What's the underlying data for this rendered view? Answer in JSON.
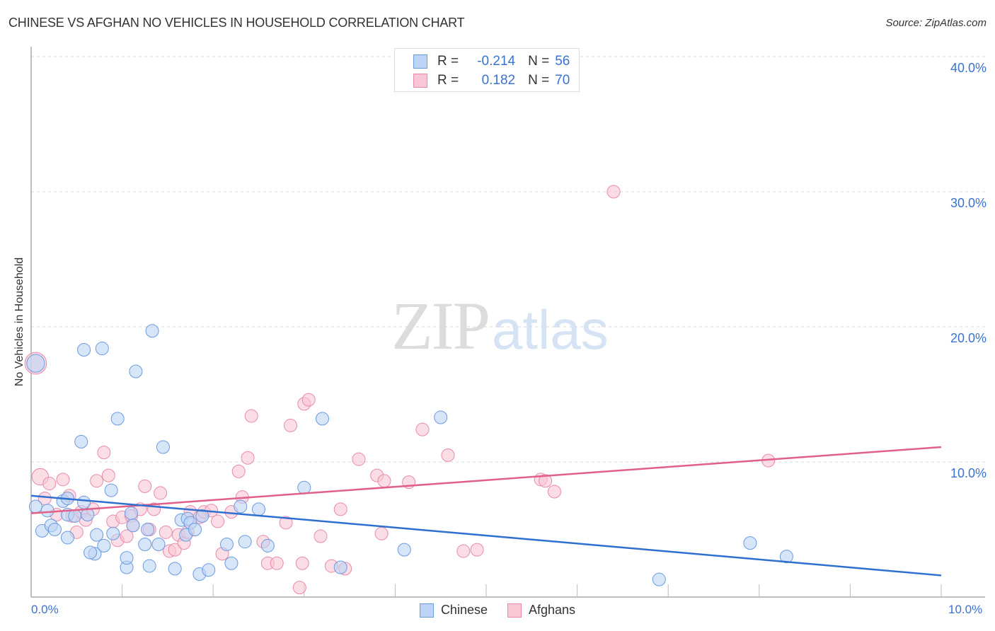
{
  "header": {
    "title": "CHINESE VS AFGHAN NO VEHICLES IN HOUSEHOLD CORRELATION CHART",
    "source": "Source: ZipAtlas.com"
  },
  "watermark": {
    "zip": "ZIP",
    "atlas": "atlas"
  },
  "legend_top": {
    "rows": [
      {
        "r_label": "R =",
        "r_value": "-0.214",
        "n_label": "N =",
        "n_value": "56",
        "series": "Chinese"
      },
      {
        "r_label": "R =",
        "r_value": "0.182",
        "n_label": "N =",
        "n_value": "70",
        "series": "Afghans"
      }
    ]
  },
  "colors": {
    "chinese_fill": "#bcd4f5",
    "chinese_stroke": "#6a9ae0",
    "chinese_line": "#2f6fcf",
    "afghans_fill": "#f9c6d6",
    "afghans_stroke": "#e88aa7",
    "afghans_line": "#e0608a",
    "tick_text": "#3a72d0"
  },
  "chart_data": {
    "type": "scatter",
    "title": "CHINESE VS AFGHAN NO VEHICLES IN HOUSEHOLD CORRELATION CHART",
    "xlabel": "",
    "ylabel": "No Vehicles in Household",
    "xlim": [
      0,
      10
    ],
    "ylim": [
      0,
      40
    ],
    "x_unit": "%",
    "y_unit": "%",
    "x_ticks": [
      "0.0%",
      "10.0%"
    ],
    "y_ticks": [
      "10.0%",
      "20.0%",
      "30.0%",
      "40.0%"
    ],
    "y_tick_values": [
      10,
      20,
      30,
      40
    ],
    "grid": "horizontal-dashed",
    "legend": "bottom-center",
    "series": [
      {
        "name": "Chinese",
        "r": -0.214,
        "n": 56,
        "trend": {
          "x": [
            0,
            10
          ],
          "y": [
            7.5,
            1.6
          ]
        },
        "points": [
          [
            0.05,
            17.3,
            1.4
          ],
          [
            0.05,
            6.7
          ],
          [
            0.12,
            4.9
          ],
          [
            0.18,
            6.4
          ],
          [
            0.22,
            5.3
          ],
          [
            0.26,
            5.0
          ],
          [
            0.35,
            7.1
          ],
          [
            0.4,
            7.3
          ],
          [
            0.4,
            6.1
          ],
          [
            0.4,
            4.4
          ],
          [
            0.48,
            6.0
          ],
          [
            0.55,
            11.5
          ],
          [
            0.58,
            18.3
          ],
          [
            0.62,
            6.1
          ],
          [
            0.58,
            7.0
          ],
          [
            0.7,
            3.2
          ],
          [
            0.65,
            3.3
          ],
          [
            0.72,
            4.6
          ],
          [
            0.78,
            18.4
          ],
          [
            0.8,
            3.8
          ],
          [
            0.88,
            7.9
          ],
          [
            0.9,
            4.7
          ],
          [
            0.95,
            13.2
          ],
          [
            1.05,
            2.2
          ],
          [
            1.05,
            2.9
          ],
          [
            1.1,
            6.2
          ],
          [
            1.12,
            5.3
          ],
          [
            1.15,
            16.7
          ],
          [
            1.25,
            3.9
          ],
          [
            1.28,
            5.0
          ],
          [
            1.3,
            2.3
          ],
          [
            1.33,
            19.7
          ],
          [
            1.4,
            3.9
          ],
          [
            1.45,
            11.1
          ],
          [
            1.58,
            2.1
          ],
          [
            1.65,
            5.7
          ],
          [
            1.7,
            4.6
          ],
          [
            1.72,
            5.8
          ],
          [
            1.75,
            5.5
          ],
          [
            1.8,
            5.0
          ],
          [
            1.88,
            6.0
          ],
          [
            1.85,
            1.7
          ],
          [
            1.95,
            2.0
          ],
          [
            2.15,
            3.9
          ],
          [
            2.2,
            2.5
          ],
          [
            2.3,
            6.7
          ],
          [
            2.35,
            4.1
          ],
          [
            2.5,
            6.5
          ],
          [
            2.6,
            3.8
          ],
          [
            3.0,
            8.1
          ],
          [
            3.2,
            13.2
          ],
          [
            3.4,
            2.2
          ],
          [
            4.1,
            3.5
          ],
          [
            4.5,
            13.3
          ],
          [
            6.9,
            1.3
          ],
          [
            7.9,
            4.0
          ],
          [
            8.3,
            3.0
          ]
        ]
      },
      {
        "name": "Afghans",
        "r": 0.182,
        "n": 70,
        "trend": {
          "x": [
            0,
            10
          ],
          "y": [
            6.2,
            11.1
          ]
        },
        "points": [
          [
            0.05,
            17.3,
            1.7
          ],
          [
            0.1,
            8.9,
            1.3
          ],
          [
            0.15,
            7.3
          ],
          [
            0.2,
            8.4
          ],
          [
            0.28,
            6.1
          ],
          [
            0.35,
            8.7
          ],
          [
            0.42,
            7.5
          ],
          [
            0.45,
            6.0
          ],
          [
            0.5,
            4.8
          ],
          [
            0.55,
            6.3
          ],
          [
            0.6,
            5.7
          ],
          [
            0.68,
            6.5
          ],
          [
            0.72,
            8.6
          ],
          [
            0.8,
            10.7
          ],
          [
            0.85,
            9.0
          ],
          [
            0.9,
            5.6
          ],
          [
            0.95,
            4.2
          ],
          [
            1.0,
            5.9
          ],
          [
            1.05,
            4.5
          ],
          [
            1.1,
            6.0
          ],
          [
            1.12,
            5.3
          ],
          [
            1.2,
            6.5
          ],
          [
            1.25,
            8.2
          ],
          [
            1.3,
            5.0
          ],
          [
            1.35,
            6.5
          ],
          [
            1.42,
            7.7
          ],
          [
            1.48,
            4.8
          ],
          [
            1.52,
            3.4
          ],
          [
            1.58,
            3.5
          ],
          [
            1.62,
            4.6
          ],
          [
            1.68,
            4.0
          ],
          [
            1.72,
            4.8
          ],
          [
            1.75,
            6.3
          ],
          [
            1.85,
            5.9
          ],
          [
            1.9,
            6.3
          ],
          [
            1.98,
            6.4
          ],
          [
            2.05,
            5.6
          ],
          [
            2.1,
            3.2
          ],
          [
            2.2,
            6.3
          ],
          [
            2.28,
            9.3
          ],
          [
            2.32,
            7.4
          ],
          [
            2.38,
            10.3
          ],
          [
            2.42,
            13.4
          ],
          [
            2.55,
            4.1
          ],
          [
            2.6,
            2.5
          ],
          [
            2.7,
            2.5
          ],
          [
            2.8,
            5.5
          ],
          [
            2.85,
            12.7
          ],
          [
            2.95,
            0.7
          ],
          [
            2.98,
            2.5
          ],
          [
            3.0,
            14.3
          ],
          [
            3.05,
            14.6
          ],
          [
            3.18,
            4.5
          ],
          [
            3.3,
            2.3
          ],
          [
            3.4,
            6.5
          ],
          [
            3.45,
            2.1
          ],
          [
            3.6,
            10.2
          ],
          [
            3.8,
            9.0
          ],
          [
            3.88,
            8.6
          ],
          [
            3.85,
            4.7
          ],
          [
            4.15,
            8.5
          ],
          [
            4.3,
            12.4
          ],
          [
            4.58,
            10.5
          ],
          [
            4.75,
            3.4
          ],
          [
            4.9,
            3.5
          ],
          [
            5.6,
            8.7
          ],
          [
            5.65,
            8.6
          ],
          [
            5.75,
            7.8
          ],
          [
            6.4,
            30.0
          ],
          [
            8.1,
            10.1
          ]
        ]
      }
    ]
  },
  "bottom_legend": {
    "items": [
      {
        "label": "Chinese"
      },
      {
        "label": "Afghans"
      }
    ]
  }
}
